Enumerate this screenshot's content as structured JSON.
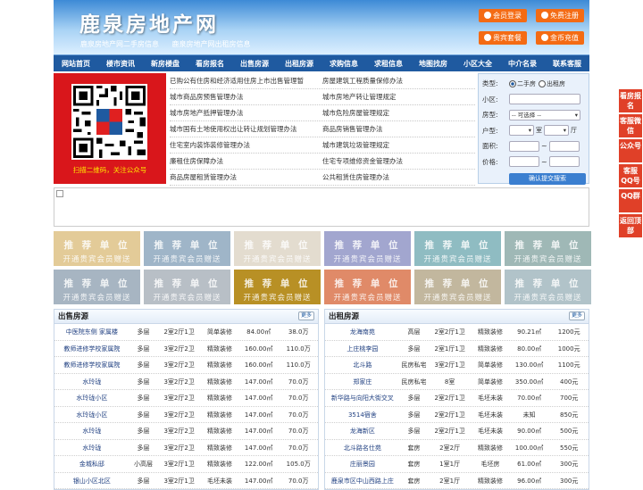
{
  "header": {
    "site_title": "鹿泉房地产网",
    "sublinks": [
      "鹿泉房地产网二手房信息",
      "鹿泉房地产网出租房信息"
    ],
    "buttons": [
      "会员登录",
      "免费注册",
      "贵宾套餐",
      "金币充值"
    ]
  },
  "nav": [
    "网站首页",
    "楼市资讯",
    "新房楼盘",
    "看房报名",
    "出售房源",
    "出租房源",
    "求购信息",
    "求租信息",
    "地图找房",
    "小区大全",
    "中介名录",
    "联系客服"
  ],
  "qr": {
    "caption": "扫描二维码，关注公众号"
  },
  "news": [
    [
      "已购公有住房和经济适用住房上市出售管理暂",
      "房屋建筑工程质量保修办法"
    ],
    [
      "城市商品房预售管理办法",
      "城市房地产转让管理规定"
    ],
    [
      "城市房地产抵押管理办法",
      "城市危险房屋管理规定"
    ],
    [
      "城市国有土地使用权出让转让规划管理办法",
      "商品房销售管理办法"
    ],
    [
      "住宅室内装饰装修管理办法",
      "城市建筑垃圾管理规定"
    ],
    [
      "廉租住房保障办法",
      "住宅专项维修资金管理办法"
    ],
    [
      "商品房屋租赁管理办法",
      "公共租赁住房管理办法"
    ]
  ],
  "search": {
    "type_label": "类型:",
    "type_options": [
      "二手房",
      "出租房"
    ],
    "community_label": "小区:",
    "house_type_label": "房型:",
    "house_type_value": "-- 可选择 --",
    "layout_label": "户型:",
    "room_unit": "室",
    "hall_unit": "厅",
    "area_label": "面积:",
    "price_label": "价格:",
    "range_sep": "~",
    "submit": "确认提交搜索"
  },
  "tiles": {
    "line1": "推 荐 单 位",
    "line2": "开通贵宾会员赠送"
  },
  "sale": {
    "title": "出售房源",
    "more": "更多",
    "rows": [
      [
        "中医院东侧 家属楼",
        "多层",
        "2室2厅1卫",
        "简单装修",
        "84.00㎡",
        "38.0万"
      ],
      [
        "教师进修学校家属院",
        "多层",
        "3室2厅2卫",
        "精致装修",
        "160.00㎡",
        "110.0万"
      ],
      [
        "教师进修学校家属院",
        "多层",
        "3室2厅2卫",
        "精致装修",
        "160.00㎡",
        "110.0万"
      ],
      [
        "水玲珑",
        "多层",
        "3室2厅2卫",
        "精致装修",
        "147.00㎡",
        "70.0万"
      ],
      [
        "水玲珑小区",
        "多层",
        "3室2厅2卫",
        "精致装修",
        "147.00㎡",
        "70.0万"
      ],
      [
        "水玲珑小区",
        "多层",
        "3室2厅2卫",
        "精致装修",
        "147.00㎡",
        "70.0万"
      ],
      [
        "水玲珑",
        "多层",
        "3室2厅2卫",
        "精致装修",
        "147.00㎡",
        "70.0万"
      ],
      [
        "水玲珑",
        "多层",
        "3室2厅2卫",
        "精致装修",
        "147.00㎡",
        "70.0万"
      ],
      [
        "金城私邸",
        "小高层",
        "3室2厅1卫",
        "精致装修",
        "122.00㎡",
        "105.0万"
      ],
      [
        "银山小区北区",
        "多层",
        "3室2厅1卫",
        "毛坯未装",
        "147.00㎡",
        "70.0万"
      ]
    ]
  },
  "rent": {
    "title": "出租房源",
    "more": "更多",
    "rows": [
      [
        "龙海南苑",
        "高层",
        "2室2厅1卫",
        "精致装修",
        "90.21㎡",
        "1200元"
      ],
      [
        "上庄桃李园",
        "多层",
        "2室1厅1卫",
        "精致装修",
        "80.00㎡",
        "1000元"
      ],
      [
        "北斗路",
        "民房私宅",
        "3室2厅1卫",
        "简单装修",
        "130.00㎡",
        "1100元"
      ],
      [
        "郑家庄",
        "民房私宅",
        "8室",
        "简单装修",
        "350.00㎡",
        "400元"
      ],
      [
        "新华路与向阳大街交叉",
        "多层",
        "2室2厅1卫",
        "毛坯未装",
        "70.00㎡",
        "700元"
      ],
      [
        "3514宿舍",
        "多层",
        "2室2厅1卫",
        "毛坯未装",
        "未知",
        "850元"
      ],
      [
        "龙海新区",
        "多层",
        "2室2厅1卫",
        "毛坯未装",
        "90.00㎡",
        "500元"
      ],
      [
        "北斗路名仕苑",
        "套房",
        "2室2厅",
        "精致装修",
        "100.00㎡",
        "550元"
      ],
      [
        "庄丽景园",
        "套房",
        "1室1厅",
        "毛坯房",
        "61.00㎡",
        "300元"
      ],
      [
        "鹿泉市区中山西路上庄",
        "套房",
        "2室1厅",
        "精致装修",
        "96.00㎡",
        "300元"
      ]
    ]
  },
  "side": [
    "看房报名",
    "客服微信",
    "公众号",
    "客服QQ号",
    "QQ群",
    "返回顶部"
  ],
  "colors": {
    "brand": "#1f5aa0",
    "accent": "#f46b14",
    "side": "#e04028"
  }
}
